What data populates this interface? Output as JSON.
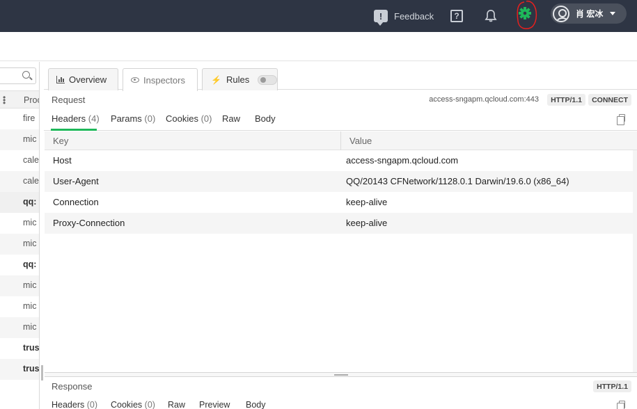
{
  "topbar": {
    "feedback_label": "Feedback",
    "user_name": "肖 宏冰",
    "accent_gear_color": "#1eb85a"
  },
  "left": {
    "column_label": "Proc",
    "rows": [
      "fire",
      "mic",
      "cale",
      "cale",
      "qq:",
      "mic",
      "mic",
      "qq:",
      "mic",
      "mic",
      "mic",
      "trus",
      "trus"
    ]
  },
  "tabs": {
    "overview": "Overview",
    "inspectors": "Inspectors",
    "rules": "Rules"
  },
  "request": {
    "title": "Request",
    "host": "access-sngapm.qcloud.com:443",
    "protocol": "HTTP/1.1",
    "method": "CONNECT",
    "subtabs": {
      "headers": "Headers",
      "headers_count": "(4)",
      "params": "Params",
      "params_count": "(0)",
      "cookies": "Cookies",
      "cookies_count": "(0)",
      "raw": "Raw",
      "body": "Body"
    },
    "table": {
      "key_header": "Key",
      "value_header": "Value",
      "rows": [
        {
          "key": "Host",
          "value": "access-sngapm.qcloud.com"
        },
        {
          "key": "User-Agent",
          "value": "QQ/20143 CFNetwork/1128.0.1 Darwin/19.6.0 (x86_64)"
        },
        {
          "key": "Connection",
          "value": "keep-alive"
        },
        {
          "key": "Proxy-Connection",
          "value": "keep-alive"
        }
      ]
    }
  },
  "response": {
    "title": "Response",
    "protocol": "HTTP/1.1",
    "subtabs": {
      "headers": "Headers",
      "headers_count": "(0)",
      "cookies": "Cookies",
      "cookies_count": "(0)",
      "raw": "Raw",
      "preview": "Preview",
      "body": "Body"
    }
  }
}
